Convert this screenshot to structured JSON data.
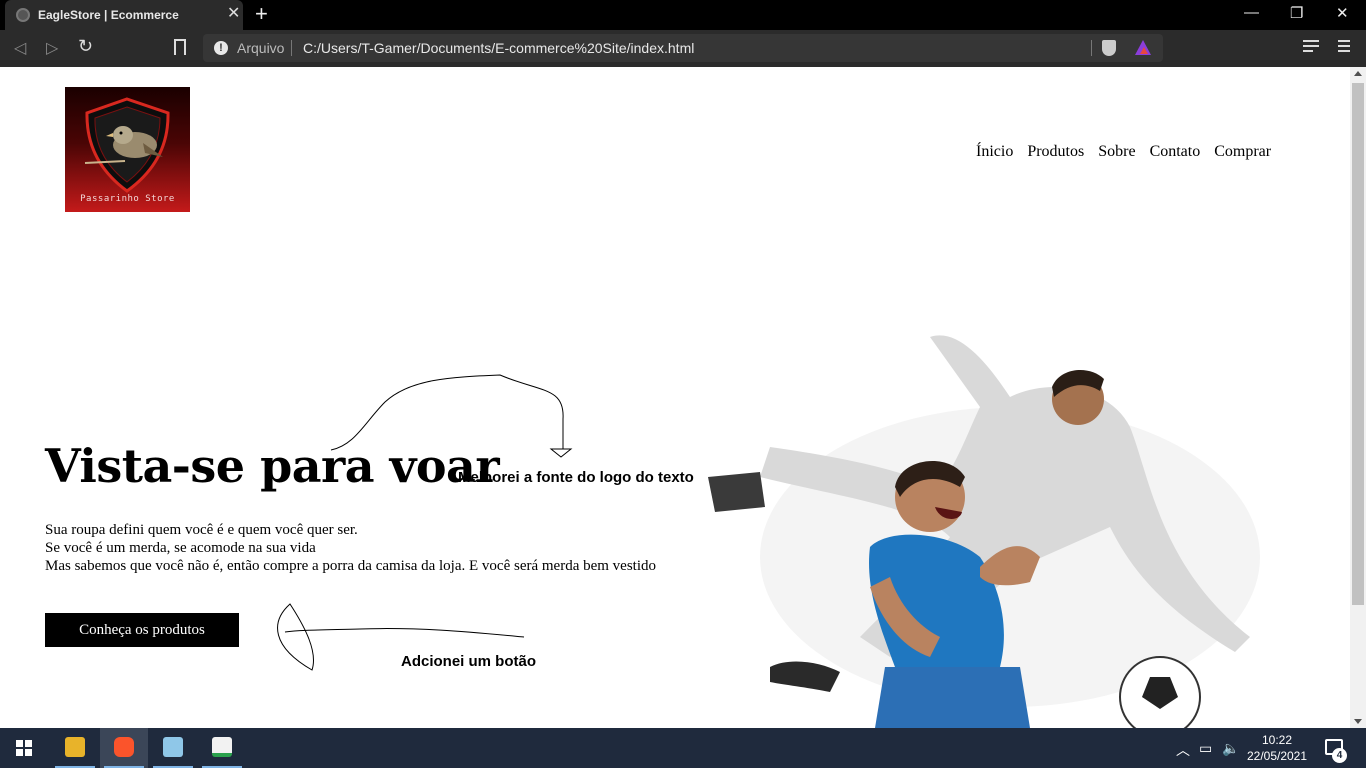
{
  "browser": {
    "tab_title": "EagleStore | Ecommerce",
    "url_scheme_label": "Arquivo",
    "url": "C:/Users/T-Gamer/Documents/E-commerce%20Site/index.html"
  },
  "page": {
    "logo_text": "Passarinho Store",
    "nav": [
      "Ínicio",
      "Produtos",
      "Sobre",
      "Contato",
      "Comprar"
    ],
    "hero_title": "Vista-se para voar",
    "hero_lines": [
      "Sua roupa defini quem você é e quem você quer ser.",
      "Se você é um merda, se acomode na sua vida",
      "Mas sabemos que você não é, então compre a porra da camisa da loja. E você será merda bem vestido"
    ],
    "hero_button": "Conheça os produtos",
    "annotations": {
      "logo_font_note": "Melhorei a fonte do logo do texto",
      "button_note": "Adcionei um botão"
    }
  },
  "taskbar": {
    "time": "10:22",
    "date": "22/05/2021",
    "notification_count": "4",
    "apps": [
      "file-explorer",
      "brave-browser",
      "notepad",
      "spreadsheet"
    ]
  },
  "colors": {
    "chrome_bg": "#000000",
    "toolbar_bg": "#2b2b2b",
    "taskbar_bg": "#1f2a3d",
    "button_bg": "#000000",
    "logo_red": "#c41a1a"
  }
}
